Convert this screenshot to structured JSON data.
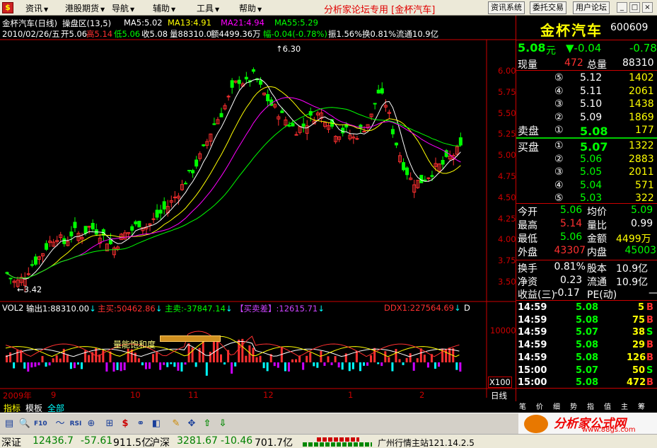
{
  "menubar": {
    "items": [
      {
        "label": "资讯",
        "arrow": "▼"
      },
      {
        "label": "港股期货",
        "arrow": "▼"
      },
      {
        "label": "导航",
        "arrow": "▼"
      },
      {
        "label": "辅助",
        "arrow": "▼"
      },
      {
        "label": "工具",
        "arrow": "▼"
      },
      {
        "label": "帮助",
        "arrow": "▼"
      }
    ],
    "title": "分析家论坛专用 [金杯汽车]",
    "buttons": [
      "资讯系统",
      "委托交易",
      "用户论坛"
    ],
    "win_buttons": [
      "_",
      "□",
      "×"
    ]
  },
  "kline": {
    "header": {
      "name": "金杯汽车(日线)",
      "mode": "操盘区(13,5)",
      "ma5": "MA5:5.02",
      "ma13": "MA13:4.91",
      "ma21": "MA21:4.94",
      "ma55": "MA55:5.29"
    },
    "info": {
      "date": "2010/02/26/五",
      "open": "开5.06",
      "high": "高5.14",
      "low": "低5.06",
      "close": "收5.08",
      "vol": "量88310.0",
      "amount": "额4499.36万",
      "range": "幅-0.04(-0.78%)",
      "amp": "振1.56%",
      "turnover": "换0.81%",
      "float": "流通10.9亿"
    },
    "max_label": "6.30",
    "min_label": "3.42",
    "price_ticks": [
      "6.00",
      "5.75",
      "5.50",
      "5.25",
      "5.00",
      "4.75",
      "4.50",
      "4.25",
      "4.00",
      "3.75",
      "3.50"
    ]
  },
  "vol_panel": {
    "name": "VOL2",
    "out": "输出1:88310.00",
    "buy": "主买:50462.86",
    "sell": "主卖:-37847.14",
    "diff": "【买卖差】:12615.71",
    "ddx": "DDX1:227564.69",
    "d": "D",
    "tick": "10000",
    "multiplier": "X100",
    "annotation": "量能饱和度"
  },
  "xaxis": {
    "labels": [
      "2009年",
      "9",
      "10",
      "11",
      "12",
      "1",
      "2"
    ],
    "period": "日线"
  },
  "stock": {
    "name": "金杯汽车",
    "code": "600609",
    "price": "5.08",
    "unit": "元",
    "change": "▼-0.04",
    "pct": "-0.78",
    "now_vol_label": "现量",
    "now_vol": "472",
    "total_vol_label": "总量",
    "total_vol": "88310"
  },
  "sell_orders": [
    {
      "n": "⑤",
      "price": "5.12",
      "vol": "1402"
    },
    {
      "n": "④",
      "price": "5.11",
      "vol": "2061"
    },
    {
      "n": "③",
      "price": "5.10",
      "vol": "1438"
    },
    {
      "n": "②",
      "price": "5.09",
      "vol": "1869"
    },
    {
      "n": "①",
      "price": "5.08",
      "vol": "177"
    }
  ],
  "buy_orders": [
    {
      "n": "①",
      "price": "5.07",
      "vol": "1322"
    },
    {
      "n": "②",
      "price": "5.06",
      "vol": "2883"
    },
    {
      "n": "③",
      "price": "5.05",
      "vol": "2011"
    },
    {
      "n": "④",
      "price": "5.04",
      "vol": "571"
    },
    {
      "n": "⑤",
      "price": "5.03",
      "vol": "322"
    }
  ],
  "sell_label": "卖盘",
  "buy_label": "买盘",
  "stats": [
    {
      "l1": "今开",
      "v1": "5.06",
      "l2": "均价",
      "v2": "5.09"
    },
    {
      "l1": "最高",
      "v1": "5.14",
      "l2": "量比",
      "v2": "0.99"
    },
    {
      "l1": "最低",
      "v1": "5.06",
      "l2": "金额",
      "v2": "4499万"
    },
    {
      "l1": "外盘",
      "v1": "43307",
      "l2": "内盘",
      "v2": "45003"
    }
  ],
  "stats2": [
    {
      "l1": "换手",
      "v1": "0.81%",
      "l2": "股本",
      "v2": "10.9亿"
    },
    {
      "l1": "净资",
      "v1": "0.23",
      "l2": "流通",
      "v2": "10.9亿"
    },
    {
      "l1": "收益(三)",
      "v1": "-0.17",
      "l2": "PE(动)",
      "v2": "—"
    }
  ],
  "ticks": [
    {
      "t": "14:59",
      "p": "5.08",
      "v": "5",
      "d": "B"
    },
    {
      "t": "14:59",
      "p": "5.08",
      "v": "75",
      "d": "B"
    },
    {
      "t": "14:59",
      "p": "5.07",
      "v": "38",
      "d": "S"
    },
    {
      "t": "14:59",
      "p": "5.08",
      "v": "29",
      "d": "B"
    },
    {
      "t": "14:59",
      "p": "5.08",
      "v": "126",
      "d": "B"
    },
    {
      "t": "15:00",
      "p": "5.07",
      "v": "50",
      "d": "S"
    },
    {
      "t": "15:00",
      "p": "5.08",
      "v": "472",
      "d": "B"
    }
  ],
  "right_tabs": [
    "笔",
    "价",
    "细",
    "势",
    "指",
    "值",
    "主",
    "筹"
  ],
  "bottom_tabs": [
    "指标",
    "模板",
    "全部"
  ],
  "status": {
    "sz_name": "深证",
    "sz_val": "12436.7",
    "sz_chg": "-57.61",
    "sz_amt": "911.5亿",
    "hs_name": "沪深",
    "hs_val": "3281.67",
    "hs_chg": "-10.46",
    "hs_amt": "701.7亿",
    "station": "广州行情主站121.14.2.5"
  },
  "watermark": "分析家公式网",
  "watermark_url": "www.88gs.com",
  "colors": {
    "up": "#ff3030",
    "down": "#00ff00",
    "ma5": "#ffffff",
    "ma13": "#ffff00",
    "ma21": "#ff00ff",
    "ma55": "#00ff00"
  }
}
